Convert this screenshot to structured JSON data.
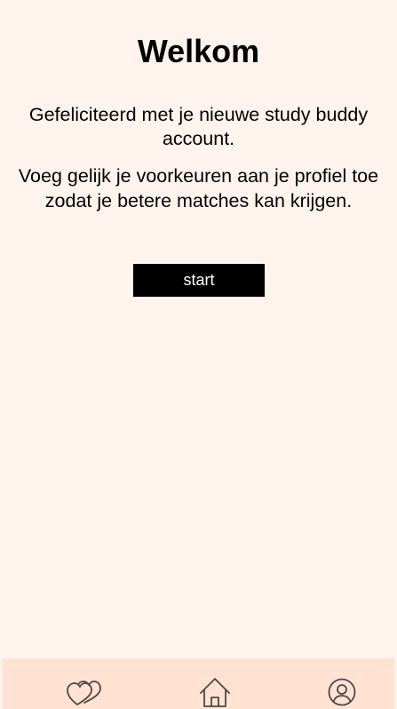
{
  "welcome": {
    "title": "Welkom",
    "congrats": "Gefeliciteerd met je nieuwe study buddy account.",
    "instructions": "Voeg gelijk je voorkeuren aan je profiel toe zodat je betere matches kan krijgen.",
    "start_label": "start"
  },
  "bottom_nav": {
    "items": [
      {
        "name": "matches",
        "icon": "hearts-icon"
      },
      {
        "name": "home",
        "icon": "home-icon"
      },
      {
        "name": "profile",
        "icon": "user-circle-icon"
      }
    ]
  },
  "colors": {
    "background": "#fff3ee",
    "nav_background": "#ffe2d1",
    "button_background": "#000000",
    "button_text": "#ffffff",
    "icon_stroke": "#4a4a4a"
  }
}
